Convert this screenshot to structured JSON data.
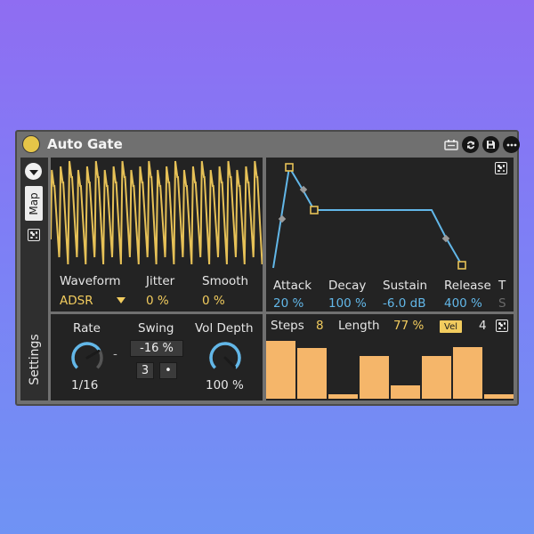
{
  "device": {
    "title": "Auto Gate",
    "colors": {
      "accent_yellow": "#f2cc5e",
      "accent_blue": "#62b7e8",
      "panel": "#232323",
      "body": "#707070"
    },
    "titlebar_icons": [
      "tape-icon",
      "refresh-icon",
      "save-icon",
      "more-icon"
    ]
  },
  "sidebar": {
    "map_label": "Map",
    "settings_label": "Settings"
  },
  "waveform": {
    "labels": {
      "waveform": "Waveform",
      "jitter": "Jitter",
      "smooth": "Smooth"
    },
    "waveform_value": "ADSR",
    "jitter_value": "0 %",
    "smooth_value": "0 %"
  },
  "envelope": {
    "attack_label": "Attack",
    "decay_label": "Decay",
    "sustain_label": "Sustain",
    "release_label": "Release",
    "extra_label": "T",
    "extra_value": "S",
    "attack_value": "20 %",
    "decay_value": "100 %",
    "sustain_value": "-6.0 dB",
    "release_value": "400 %"
  },
  "settings": {
    "rate_label": "Rate",
    "rate_value": "1/16",
    "rate_level": 0.72,
    "swing_label": "Swing",
    "swing_value": "-16 %",
    "triplet_value": "3",
    "dot_value": "•",
    "divider": "-",
    "vol_depth_label": "Vol Depth",
    "vol_depth_value": "100 %",
    "vol_depth_level": 1.0
  },
  "sequencer": {
    "steps_label": "Steps",
    "steps_value": "8",
    "length_label": "Length",
    "length_value": "77 %",
    "vel_label": "Vel",
    "count_value": "4",
    "step_levels": [
      1.0,
      0.88,
      0.07,
      0.74,
      0.23,
      0.74,
      0.9,
      0.07
    ]
  }
}
